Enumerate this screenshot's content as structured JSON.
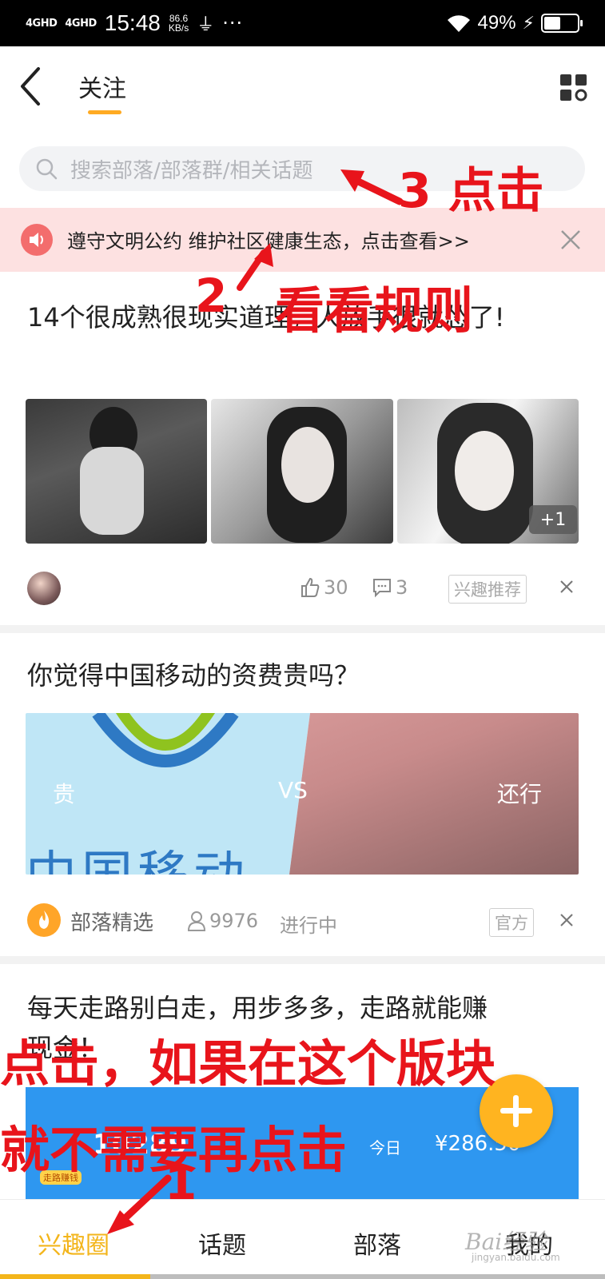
{
  "status_bar": {
    "signal1": "4GHD",
    "signal2": "4GHD",
    "time": "15:48",
    "speed_value": "86.6",
    "speed_unit": "KB/s",
    "more": "···",
    "battery_percent": "49%"
  },
  "header": {
    "active_tab": "关注",
    "accent_color": "#ffaa22"
  },
  "search": {
    "placeholder": "搜索部落/部落群/相关话题"
  },
  "notice": {
    "text": "遵守文明公约 维护社区健康生态，点击查看>>"
  },
  "posts": [
    {
      "title": "14个很成熟很现实道理，人放手很就怂了!",
      "extra_images": "+1",
      "likes": "30",
      "comments": "3",
      "tag": "兴趣推荐"
    },
    {
      "title": "你觉得中国移动的资费贵吗？",
      "banner_left": "贵",
      "banner_vs": "VS",
      "banner_right": "还行",
      "banner_cm": "中国移动",
      "source": "部落精选",
      "participants": "9976",
      "status": "进行中",
      "tag": "官方"
    },
    {
      "title": "每天走路别白走，用步多多，走路就能赚",
      "title_line2": "现金！",
      "banner_steps": "10289",
      "banner_badge": "走路赚钱",
      "banner_amount": "¥286.50",
      "banner_label": "今日"
    }
  ],
  "bottom_nav": {
    "items": [
      "兴趣圈",
      "话题",
      "部落",
      "我的"
    ],
    "active_color": "#f3b51b"
  },
  "annotations": {
    "step3": "3 点击",
    "step2_num": "2",
    "step2_text": "看看规则",
    "step1_line1": "点击，如果在这个版块",
    "step1_line2": "就不需要再点击",
    "step1_num": "1",
    "color": "#e8141b"
  },
  "watermark": {
    "main": "Bai经验",
    "sub": "jingyan.baidu.com"
  }
}
